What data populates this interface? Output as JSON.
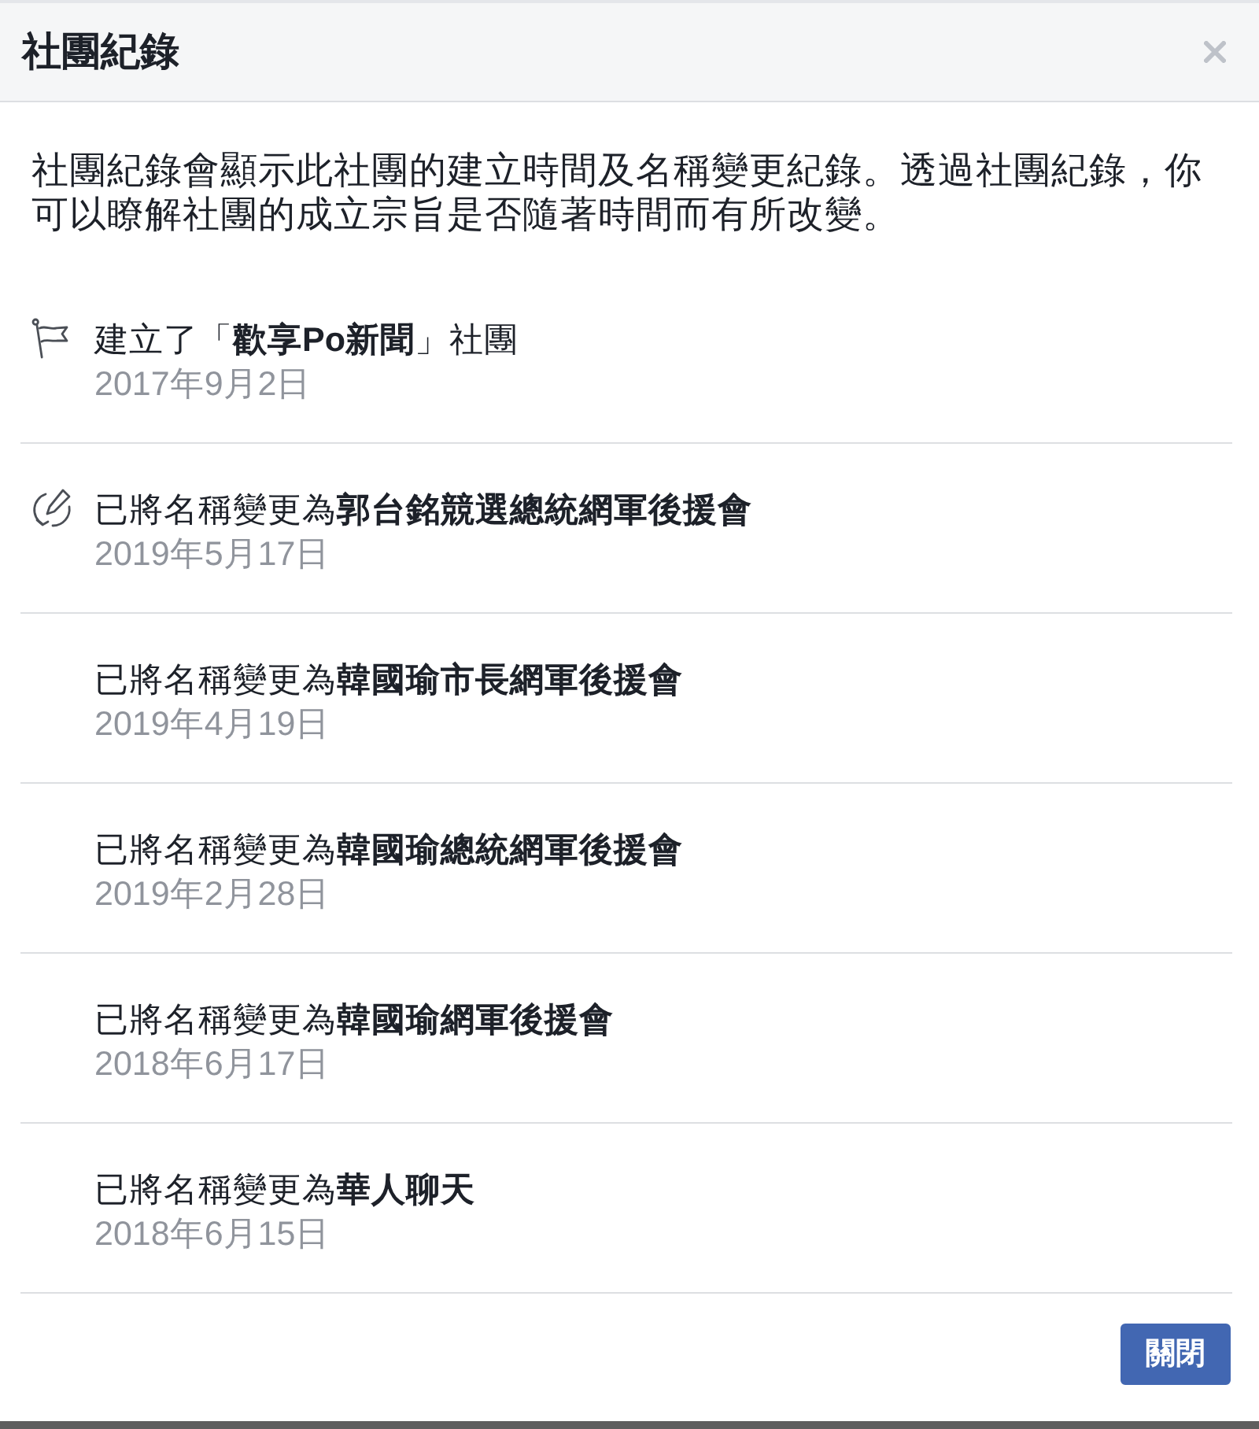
{
  "dialog": {
    "title": "社團紀錄",
    "description": "社團紀錄會顯示此社團的建立時間及名稱變更紀錄。透過社團紀錄，你可以瞭解社團的成立宗旨是否隨著時間而有所改變。"
  },
  "history": [
    {
      "kind": "created",
      "text": "建立了「**歡享Po新聞**」社團",
      "date": "2017年9月2日"
    },
    {
      "kind": "renamed",
      "text": "已將名稱變更為**郭台銘競選總統網軍後援會**",
      "date": "2019年5月17日"
    },
    {
      "kind": "plain",
      "text": "已將名稱變更為**韓國瑜市長網軍後援會**",
      "date": "2019年4月19日"
    },
    {
      "kind": "plain",
      "text": "已將名稱變更為**韓國瑜總統網軍後援會**",
      "date": "2019年2月28日"
    },
    {
      "kind": "plain",
      "text": "已將名稱變更為**韓國瑜網軍後援會**",
      "date": "2018年6月17日"
    },
    {
      "kind": "plain",
      "text": "已將名稱變更為**華人聊天**",
      "date": "2018年6月15日"
    }
  ],
  "footer": {
    "button": "關閉"
  }
}
